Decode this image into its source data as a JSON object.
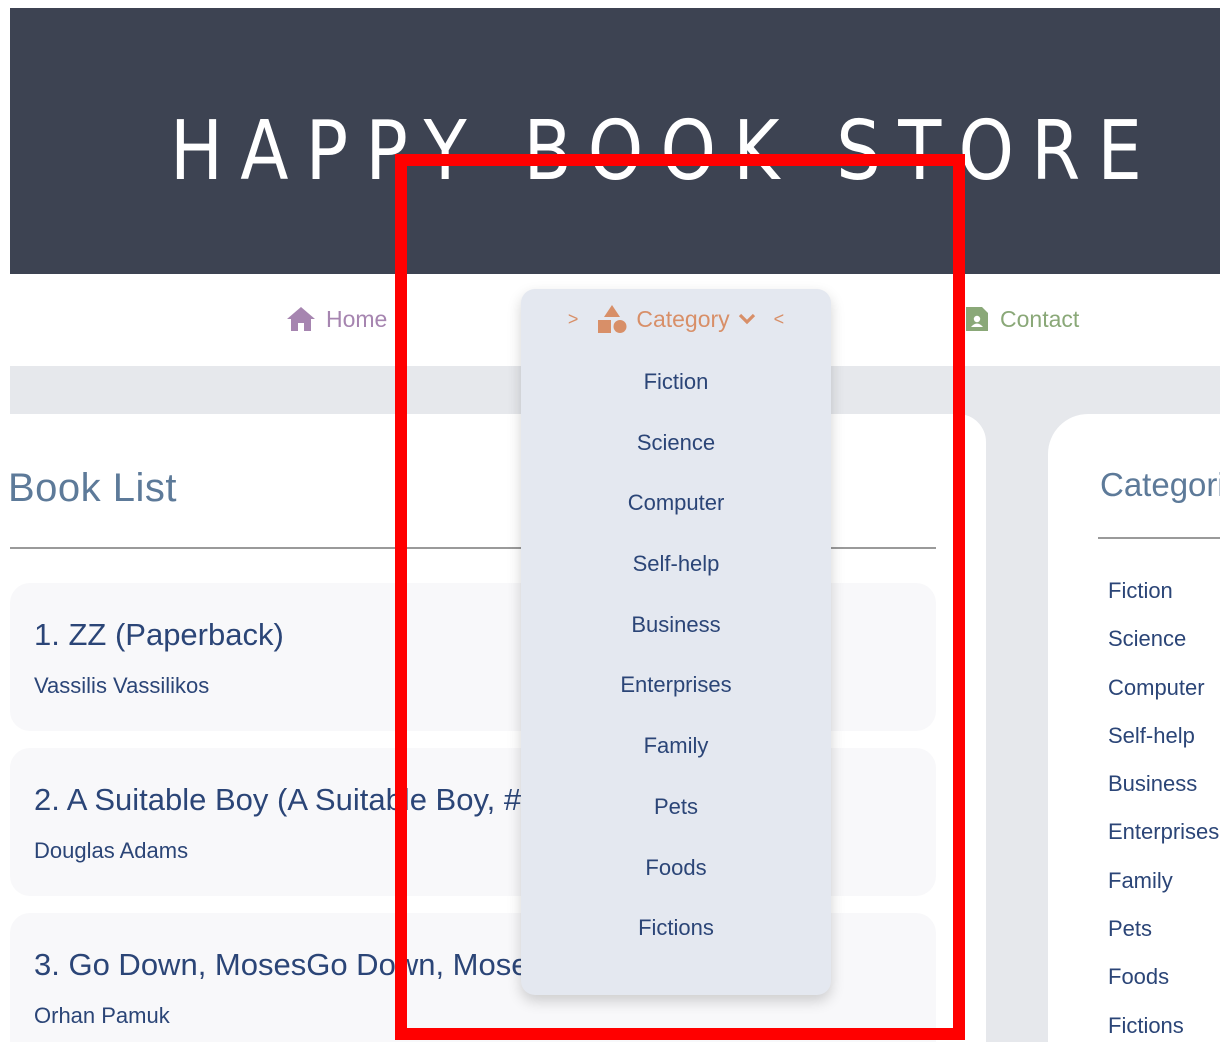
{
  "site": {
    "title": "HAPPY BOOK STORE"
  },
  "nav": {
    "home_label": "Home",
    "category_label": "Category",
    "category_prefix": ">",
    "category_suffix": "<",
    "contact_label": "Contact"
  },
  "category_dropdown": {
    "items": [
      "Fiction",
      "Science",
      "Computer",
      "Self-help",
      "Business",
      "Enterprises",
      "Family",
      "Pets",
      "Foods",
      "Fictions"
    ]
  },
  "book_list": {
    "title": "Book List",
    "books": [
      {
        "title": "1. ZZ (Paperback)",
        "author": "Vassilis Vassilikos"
      },
      {
        "title": "2. A Suitable Boy (A Suitable Boy, #",
        "author": "Douglas Adams"
      },
      {
        "title": "3. Go Down, MosesGo Down, Moses",
        "author": "Orhan Pamuk"
      }
    ]
  },
  "sidebar": {
    "title": "Categori",
    "items": [
      "Fiction",
      "Science",
      "Computer",
      "Self-help",
      "Business",
      "Enterprises",
      "Family",
      "Pets",
      "Foods",
      "Fictions"
    ]
  },
  "colors": {
    "header_bg": "#3d4352",
    "home": "#a685b0",
    "category": "#d88f68",
    "contact": "#8aa878",
    "text_dark": "#2b4577",
    "highlight_frame": "#ff0000"
  },
  "icons": {
    "home": "house-icon",
    "category": "shapes-icon",
    "dropdown": "chevron-down-icon",
    "contact": "contact-card-icon"
  }
}
